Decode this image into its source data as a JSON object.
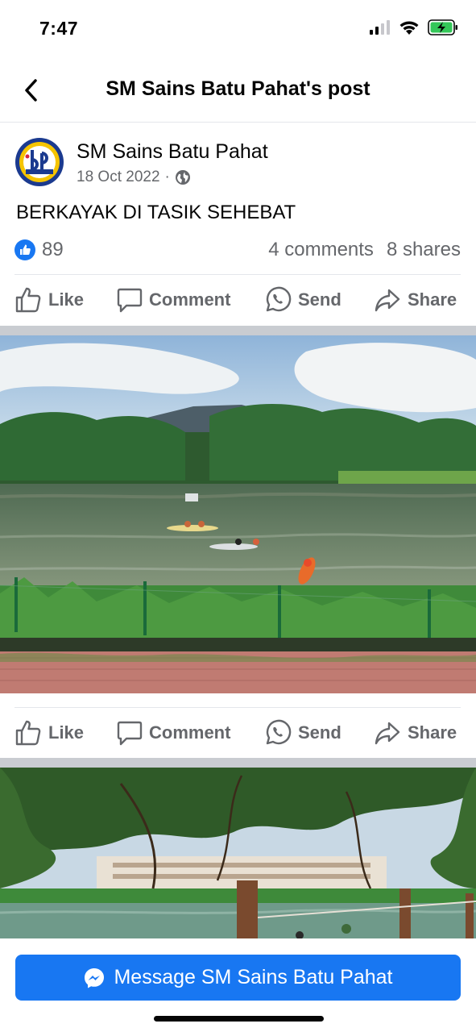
{
  "status_bar": {
    "time": "7:47"
  },
  "nav": {
    "title": "SM Sains Batu Pahat's post"
  },
  "post": {
    "author": "SM Sains Batu Pahat",
    "date": "18 Oct 2022",
    "separator": "·",
    "text": "BERKAYAK DI TASIK SEHEBAT",
    "like_count": "89",
    "comments": "4 comments",
    "shares": "8 shares"
  },
  "actions": {
    "like": "Like",
    "comment": "Comment",
    "send": "Send",
    "share": "Share"
  },
  "bottom": {
    "message_button": "Message SM Sains Batu Pahat"
  },
  "colors": {
    "brand_blue": "#1877f2",
    "secondary_text": "#65676b",
    "battery_green": "#34c759"
  }
}
